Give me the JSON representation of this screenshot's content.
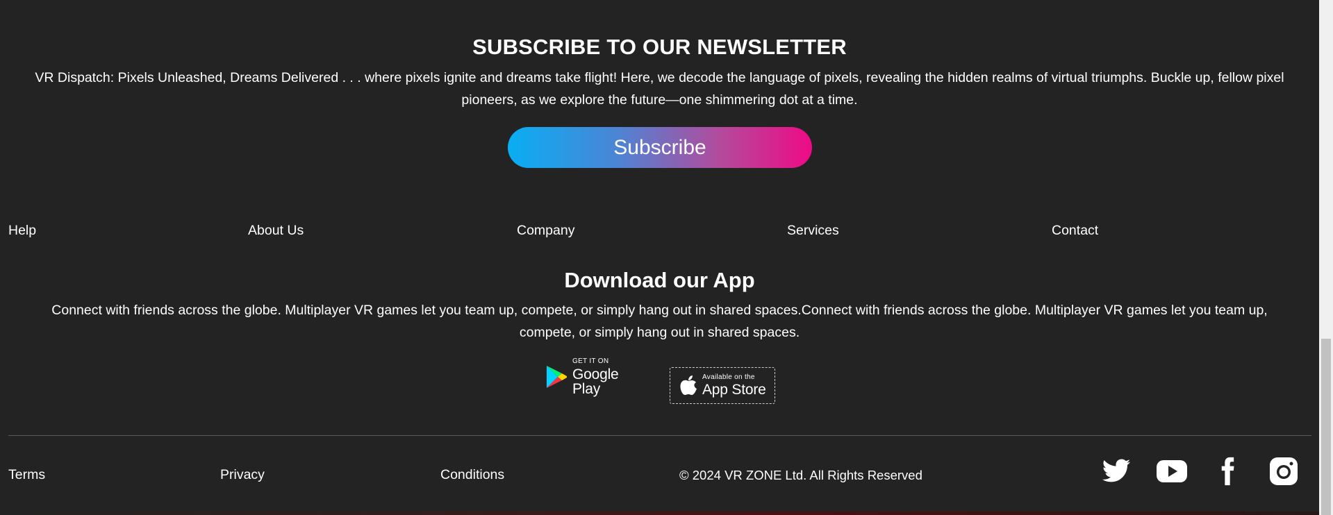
{
  "newsletter": {
    "title": "SUBSCRIBE TO OUR NEWSLETTER",
    "description": "VR Dispatch: Pixels Unleashed, Dreams Delivered . . . where pixels ignite and dreams take flight! Here, we decode the language of pixels, revealing the hidden realms of virtual triumphs. Buckle up, fellow pixel pioneers, as we explore the future—one shimmering dot at a time.",
    "button_label": "Subscribe"
  },
  "nav": {
    "items": [
      "Help",
      "About Us",
      "Company",
      "Services",
      "Contact"
    ]
  },
  "app": {
    "title": "Download our App",
    "description": "Connect with friends across the globe. Multiplayer VR games let you team up, compete, or simply hang out in shared spaces.Connect with friends across the globe. Multiplayer VR games let you team up, compete, or simply hang out in shared spaces.",
    "google_play": {
      "small": "GET IT ON",
      "big": "Google Play",
      "icon": "google-play-icon"
    },
    "app_store": {
      "small": "Available on the",
      "big": "App Store",
      "icon": "apple-icon"
    }
  },
  "footer": {
    "links": [
      "Terms",
      "Privacy",
      "Conditions"
    ],
    "copyright": "© 2024 VR ZONE Ltd. All Rights Reserved",
    "social": [
      "twitter-icon",
      "youtube-icon",
      "facebook-icon",
      "instagram-icon"
    ]
  },
  "colors": {
    "background": "#232323",
    "gradient_start": "#08aef3",
    "gradient_end": "#ee0a86",
    "text": "#ffffff"
  }
}
